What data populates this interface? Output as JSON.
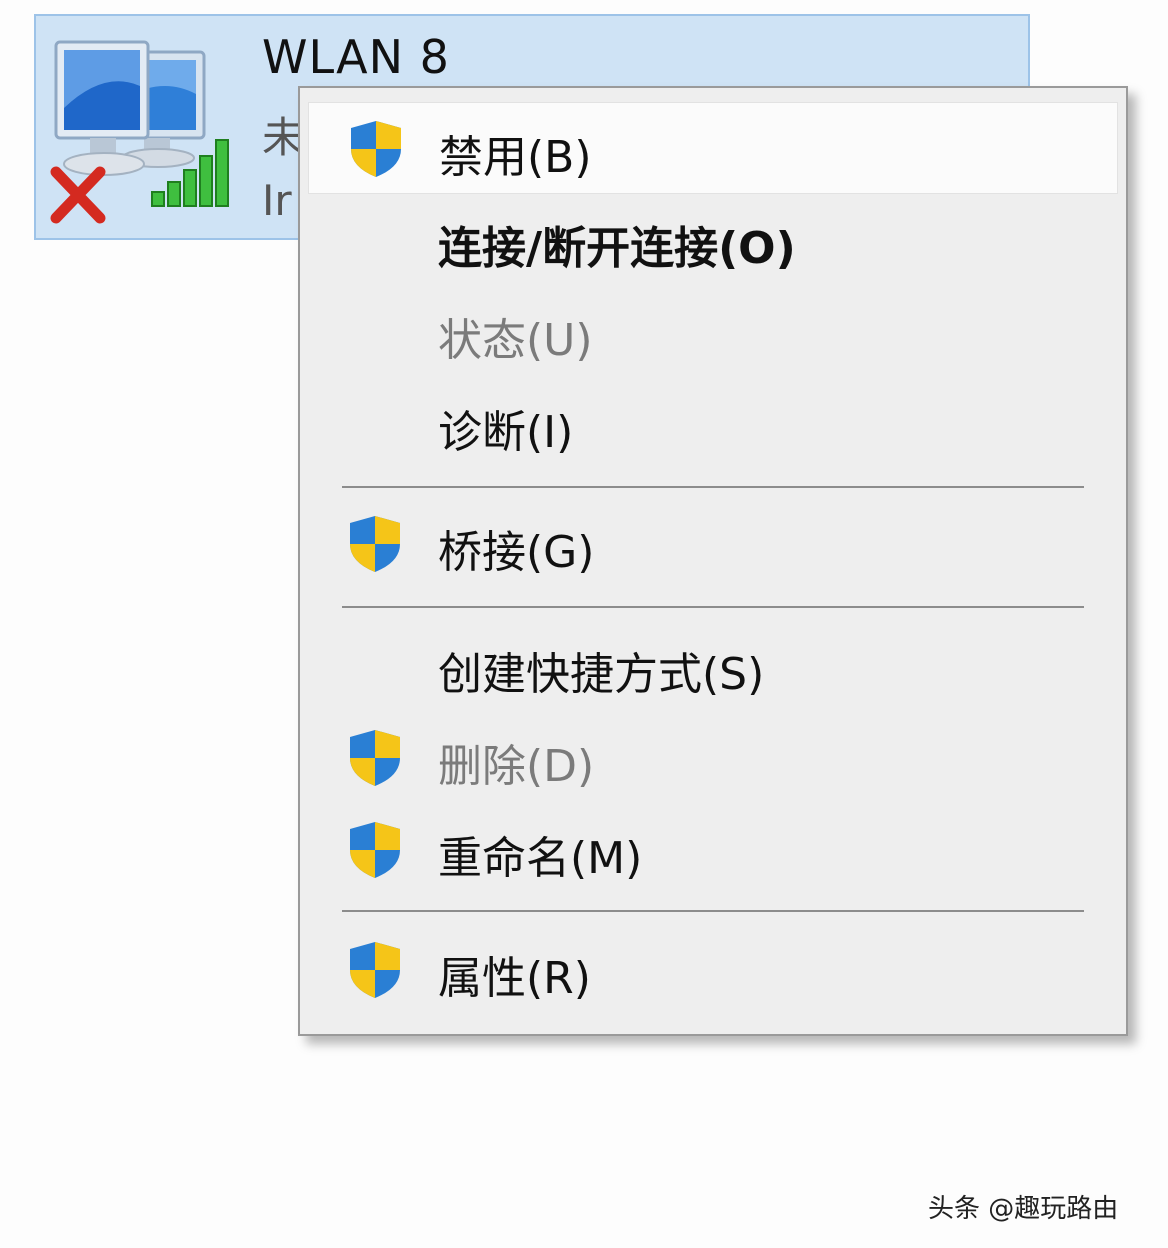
{
  "adapter": {
    "name": "WLAN 8",
    "status": "未",
    "device": "Ir",
    "icon": "network-computers-icon",
    "state_icon": "red-x-icon",
    "signal_icon": "signal-bars-icon"
  },
  "menu": {
    "items": [
      {
        "label": "禁用(B)",
        "shield": true,
        "style": "normal",
        "hover": true
      },
      {
        "label": "连接/断开连接(O)",
        "shield": false,
        "style": "bold",
        "hover": false
      },
      {
        "label": "状态(U)",
        "shield": false,
        "style": "disabled",
        "hover": false
      },
      {
        "label": "诊断(I)",
        "shield": false,
        "style": "normal",
        "hover": false
      },
      {
        "label": "桥接(G)",
        "shield": true,
        "style": "normal",
        "hover": false
      },
      {
        "label": "创建快捷方式(S)",
        "shield": false,
        "style": "normal",
        "hover": false
      },
      {
        "label": "删除(D)",
        "shield": true,
        "style": "disabled",
        "hover": false
      },
      {
        "label": "重命名(M)",
        "shield": true,
        "style": "normal",
        "hover": false
      },
      {
        "label": "属性(R)",
        "shield": true,
        "style": "normal",
        "hover": false
      }
    ]
  },
  "watermark": "头条 @趣玩路由",
  "colors": {
    "card_bg": "#cfe3f5",
    "card_border": "#9dc3e8",
    "menu_bg": "#eeeeee",
    "disabled_text": "#7b7b7b",
    "shield_blue": "#2a7fd4",
    "shield_yellow": "#f5c518"
  }
}
